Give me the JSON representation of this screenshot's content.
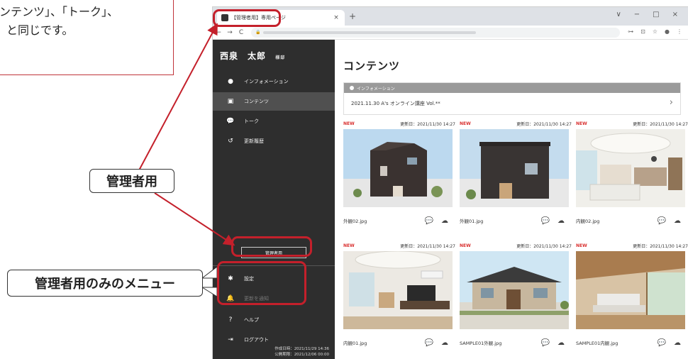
{
  "callout": {
    "line1": "ンテンツ」、「トーク」、",
    "line2": "と同じです。"
  },
  "labels": {
    "admin": "管理者用",
    "admin_only_menu": "管理者用のみのメニュー"
  },
  "browser": {
    "tab_title": "【管理者用】専用ページ",
    "tab_close": "×",
    "new_tab": "+",
    "window_controls": [
      "∨",
      "−",
      "□",
      "×"
    ],
    "nav": [
      "←",
      "→",
      "C"
    ],
    "addr_icons": [
      "⊶",
      "⊡",
      "☆",
      "●",
      "⋮"
    ]
  },
  "sidebar": {
    "user_name": "西泉　太郎",
    "user_badge": "様邸",
    "menu": [
      {
        "label": "インフォメーション",
        "icon": "info-icon",
        "active": false
      },
      {
        "label": "コンテンツ",
        "icon": "image-icon",
        "active": true
      },
      {
        "label": "トーク",
        "icon": "chat-icon",
        "active": false
      },
      {
        "label": "更新履歴",
        "icon": "history-icon",
        "active": false
      }
    ],
    "admin_button": "管理者用",
    "admin_menu": [
      {
        "label": "設定",
        "icon": "gear-icon",
        "disabled": false
      },
      {
        "label": "更新を通知",
        "icon": "bell-icon",
        "disabled": true
      }
    ],
    "bottom_menu": [
      {
        "label": "ヘルプ",
        "icon": "help-icon"
      },
      {
        "label": "ログアウト",
        "icon": "logout-icon"
      }
    ],
    "created_at": "作成日時：2021/11/29 14:36",
    "published_until": "公開期限：2021/12/06 00:00"
  },
  "main": {
    "title": "コンテンツ",
    "info_header": "インフォメーション",
    "info_item": "2021.11.30 A's オンライン講座 Vol.**",
    "cards": [
      {
        "new": "NEW",
        "updated": "更新日：2021/11/30 14:27",
        "file": "外観02.jpg",
        "scene": "ext-dark"
      },
      {
        "new": "NEW",
        "updated": "更新日：2021/11/30 14:27",
        "file": "外観01.jpg",
        "scene": "ext-dark2"
      },
      {
        "new": "NEW",
        "updated": "更新日：2021/11/30 14:27",
        "file": "内観02.jpg",
        "scene": "int-kitchen"
      },
      {
        "new": "NEW",
        "updated": "更新日：2021/11/30 14:27",
        "file": "内観01.jpg",
        "scene": "int-living"
      },
      {
        "new": "NEW",
        "updated": "更新日：2021/11/30 14:27",
        "file": "SAMPLE01外観.jpg",
        "scene": "ext-house"
      },
      {
        "new": "NEW",
        "updated": "更新日：2021/11/30 14:27",
        "file": "SAMPLE01内観.jpg",
        "scene": "int-wood"
      }
    ]
  },
  "colors": {
    "highlight": "#c4202b",
    "sidebar_bg": "#2e2e2e",
    "sidebar_active": "#505050",
    "new_badge": "#d9302f",
    "callout_border": "#c0343a"
  }
}
